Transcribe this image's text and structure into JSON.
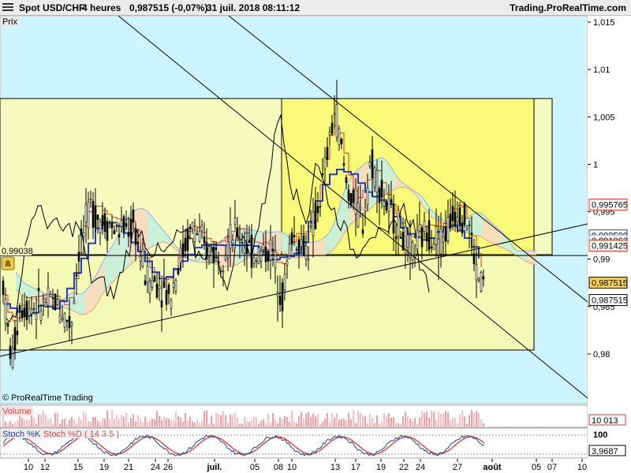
{
  "header": {
    "symbol": "Spot USD/CHF",
    "period": "4 heures",
    "value": "0,987515 (-0,07%)",
    "time": "31 juil. 2018 08:11:12",
    "brand": "Trading.ProRealTime.com"
  },
  "panes": {
    "price_label": "Prix",
    "copyright": "© ProRealTime Trading",
    "volume_label": "Volume",
    "volume_value": "10 013",
    "stoch_k_label": "Stoch %K",
    "stoch_d_label": "Stoch %D ( 14 3 5 )",
    "stoch_100": "100",
    "stoch_value": "3,9687",
    "level_label": "0,99038"
  },
  "price_badges": [
    {
      "text": "0,995765",
      "value": 0.995765,
      "color": "#d93a1c"
    },
    {
      "text": "0,992500",
      "value": 0.9925,
      "color": "#1f3fbf"
    },
    {
      "text": "0,991962",
      "value": 0.991962,
      "color": "#7f9fe0"
    },
    {
      "text": "0,991425",
      "value": 0.991425,
      "color": "#d93a1c"
    },
    {
      "text": "0,987515",
      "value": 0.987515,
      "color": "#000000",
      "filled": true
    },
    {
      "text": "0,987515",
      "value": 0.987515,
      "color": "#000000",
      "offset": 1
    }
  ],
  "colors": {
    "accent": "#1f3fbf",
    "tenkan": "#d93a1c",
    "chikou": "#000000",
    "cloud_bull": "#c7eedc",
    "cloud_bear": "#f5dcc0",
    "zone_yellow": "#fafa7a",
    "zone_pale": "#f5fab0"
  },
  "chart_data": {
    "type": "candlestick",
    "symbol": "Spot USD/CHF",
    "timeframe": "4 heures",
    "last_value": 0.987515,
    "change_pct": -0.07,
    "ylim": [
      0.976,
      1.016
    ],
    "y_ticks": [
      {
        "value": 1.015,
        "label": "1,015"
      },
      {
        "value": 1.01,
        "label": "1,01"
      },
      {
        "value": 1.005,
        "label": "1,005"
      },
      {
        "value": 1.0,
        "label": "1"
      },
      {
        "value": 0.995,
        "label": "0,995"
      },
      {
        "value": 0.99,
        "label": "0,99"
      },
      {
        "value": 0.985,
        "label": "0,985"
      },
      {
        "value": 0.98,
        "label": "0,98"
      }
    ],
    "x_ticks": [
      "10",
      "12",
      "15",
      "19",
      "21",
      "24",
      "26",
      "juil.",
      "05",
      "08",
      "10",
      "13",
      "17",
      "19",
      "22",
      "24",
      "27",
      "août",
      "05",
      "07",
      "10"
    ],
    "horizontal_level": 0.99038,
    "series": [
      {
        "name": "Stoch %K",
        "last": 3.9687
      },
      {
        "name": "Stoch %D ( 14 3 5 )"
      }
    ],
    "volume_last": 10013
  }
}
